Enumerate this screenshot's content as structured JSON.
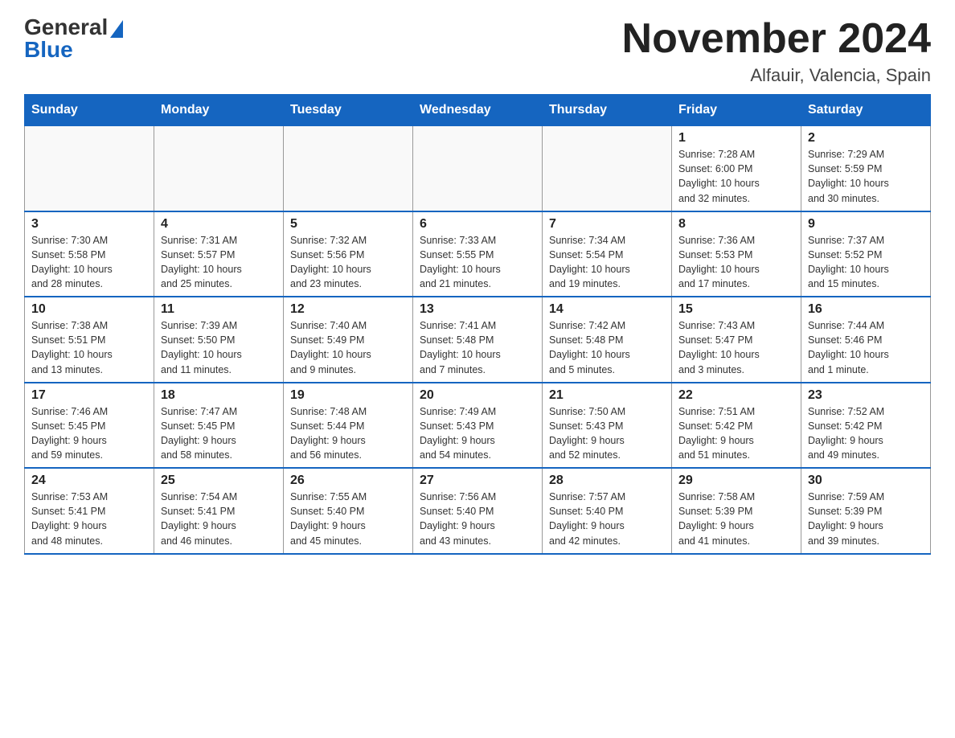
{
  "header": {
    "logo_general": "General",
    "logo_blue": "Blue",
    "month_title": "November 2024",
    "location": "Alfauir, Valencia, Spain"
  },
  "days_of_week": [
    "Sunday",
    "Monday",
    "Tuesday",
    "Wednesday",
    "Thursday",
    "Friday",
    "Saturday"
  ],
  "weeks": [
    [
      {
        "day": "",
        "info": ""
      },
      {
        "day": "",
        "info": ""
      },
      {
        "day": "",
        "info": ""
      },
      {
        "day": "",
        "info": ""
      },
      {
        "day": "",
        "info": ""
      },
      {
        "day": "1",
        "info": "Sunrise: 7:28 AM\nSunset: 6:00 PM\nDaylight: 10 hours\nand 32 minutes."
      },
      {
        "day": "2",
        "info": "Sunrise: 7:29 AM\nSunset: 5:59 PM\nDaylight: 10 hours\nand 30 minutes."
      }
    ],
    [
      {
        "day": "3",
        "info": "Sunrise: 7:30 AM\nSunset: 5:58 PM\nDaylight: 10 hours\nand 28 minutes."
      },
      {
        "day": "4",
        "info": "Sunrise: 7:31 AM\nSunset: 5:57 PM\nDaylight: 10 hours\nand 25 minutes."
      },
      {
        "day": "5",
        "info": "Sunrise: 7:32 AM\nSunset: 5:56 PM\nDaylight: 10 hours\nand 23 minutes."
      },
      {
        "day": "6",
        "info": "Sunrise: 7:33 AM\nSunset: 5:55 PM\nDaylight: 10 hours\nand 21 minutes."
      },
      {
        "day": "7",
        "info": "Sunrise: 7:34 AM\nSunset: 5:54 PM\nDaylight: 10 hours\nand 19 minutes."
      },
      {
        "day": "8",
        "info": "Sunrise: 7:36 AM\nSunset: 5:53 PM\nDaylight: 10 hours\nand 17 minutes."
      },
      {
        "day": "9",
        "info": "Sunrise: 7:37 AM\nSunset: 5:52 PM\nDaylight: 10 hours\nand 15 minutes."
      }
    ],
    [
      {
        "day": "10",
        "info": "Sunrise: 7:38 AM\nSunset: 5:51 PM\nDaylight: 10 hours\nand 13 minutes."
      },
      {
        "day": "11",
        "info": "Sunrise: 7:39 AM\nSunset: 5:50 PM\nDaylight: 10 hours\nand 11 minutes."
      },
      {
        "day": "12",
        "info": "Sunrise: 7:40 AM\nSunset: 5:49 PM\nDaylight: 10 hours\nand 9 minutes."
      },
      {
        "day": "13",
        "info": "Sunrise: 7:41 AM\nSunset: 5:48 PM\nDaylight: 10 hours\nand 7 minutes."
      },
      {
        "day": "14",
        "info": "Sunrise: 7:42 AM\nSunset: 5:48 PM\nDaylight: 10 hours\nand 5 minutes."
      },
      {
        "day": "15",
        "info": "Sunrise: 7:43 AM\nSunset: 5:47 PM\nDaylight: 10 hours\nand 3 minutes."
      },
      {
        "day": "16",
        "info": "Sunrise: 7:44 AM\nSunset: 5:46 PM\nDaylight: 10 hours\nand 1 minute."
      }
    ],
    [
      {
        "day": "17",
        "info": "Sunrise: 7:46 AM\nSunset: 5:45 PM\nDaylight: 9 hours\nand 59 minutes."
      },
      {
        "day": "18",
        "info": "Sunrise: 7:47 AM\nSunset: 5:45 PM\nDaylight: 9 hours\nand 58 minutes."
      },
      {
        "day": "19",
        "info": "Sunrise: 7:48 AM\nSunset: 5:44 PM\nDaylight: 9 hours\nand 56 minutes."
      },
      {
        "day": "20",
        "info": "Sunrise: 7:49 AM\nSunset: 5:43 PM\nDaylight: 9 hours\nand 54 minutes."
      },
      {
        "day": "21",
        "info": "Sunrise: 7:50 AM\nSunset: 5:43 PM\nDaylight: 9 hours\nand 52 minutes."
      },
      {
        "day": "22",
        "info": "Sunrise: 7:51 AM\nSunset: 5:42 PM\nDaylight: 9 hours\nand 51 minutes."
      },
      {
        "day": "23",
        "info": "Sunrise: 7:52 AM\nSunset: 5:42 PM\nDaylight: 9 hours\nand 49 minutes."
      }
    ],
    [
      {
        "day": "24",
        "info": "Sunrise: 7:53 AM\nSunset: 5:41 PM\nDaylight: 9 hours\nand 48 minutes."
      },
      {
        "day": "25",
        "info": "Sunrise: 7:54 AM\nSunset: 5:41 PM\nDaylight: 9 hours\nand 46 minutes."
      },
      {
        "day": "26",
        "info": "Sunrise: 7:55 AM\nSunset: 5:40 PM\nDaylight: 9 hours\nand 45 minutes."
      },
      {
        "day": "27",
        "info": "Sunrise: 7:56 AM\nSunset: 5:40 PM\nDaylight: 9 hours\nand 43 minutes."
      },
      {
        "day": "28",
        "info": "Sunrise: 7:57 AM\nSunset: 5:40 PM\nDaylight: 9 hours\nand 42 minutes."
      },
      {
        "day": "29",
        "info": "Sunrise: 7:58 AM\nSunset: 5:39 PM\nDaylight: 9 hours\nand 41 minutes."
      },
      {
        "day": "30",
        "info": "Sunrise: 7:59 AM\nSunset: 5:39 PM\nDaylight: 9 hours\nand 39 minutes."
      }
    ]
  ]
}
